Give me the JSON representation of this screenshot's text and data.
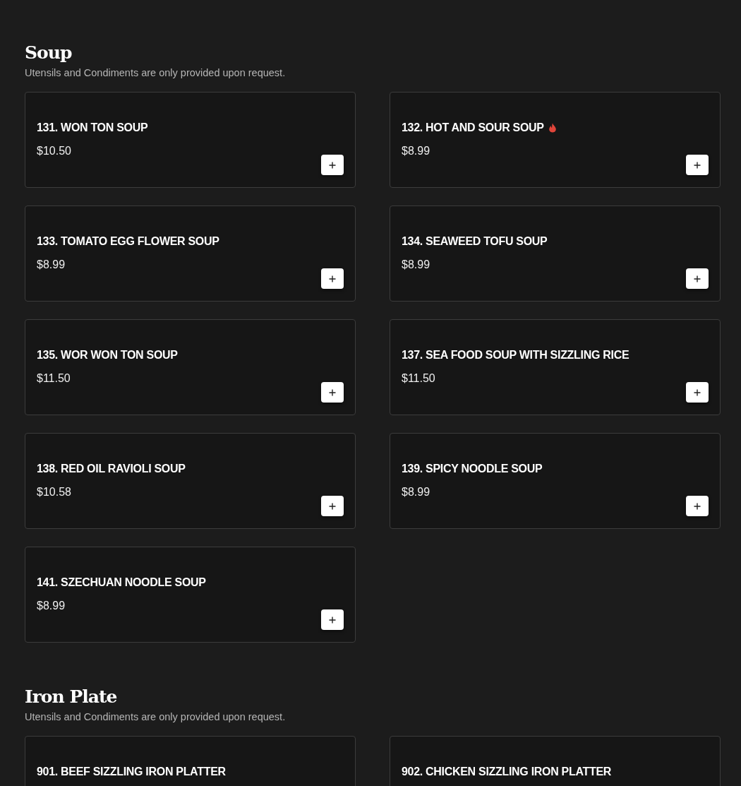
{
  "sections": [
    {
      "title": "Soup",
      "note": "Utensils and Condiments are only provided upon request.",
      "items": [
        {
          "name": "131. WON TON SOUP",
          "price": "$10.50",
          "spicy": false
        },
        {
          "name": "132. HOT AND SOUR SOUP",
          "price": "$8.99",
          "spicy": true
        },
        {
          "name": "133. TOMATO EGG FLOWER SOUP",
          "price": "$8.99",
          "spicy": false
        },
        {
          "name": "134. SEAWEED TOFU SOUP",
          "price": "$8.99",
          "spicy": false
        },
        {
          "name": "135. WOR WON TON SOUP",
          "price": "$11.50",
          "spicy": false
        },
        {
          "name": "137. SEA FOOD SOUP WITH SIZZLING RICE",
          "price": "$11.50",
          "spicy": false
        },
        {
          "name": "138. RED OIL RAVIOLI SOUP",
          "price": "$10.58",
          "spicy": false
        },
        {
          "name": "139. SPICY NOODLE SOUP",
          "price": "$8.99",
          "spicy": false
        },
        {
          "name": "141. SZECHUAN NOODLE SOUP",
          "price": "$8.99",
          "spicy": false
        }
      ]
    },
    {
      "title": "Iron Plate",
      "note": "Utensils and Condiments are only provided upon request.",
      "items": [
        {
          "name": "901. BEEF SIZZLING IRON PLATTER",
          "spicy": false
        },
        {
          "name": "902. CHICKEN SIZZLING IRON PLATTER",
          "spicy": false
        }
      ]
    }
  ]
}
